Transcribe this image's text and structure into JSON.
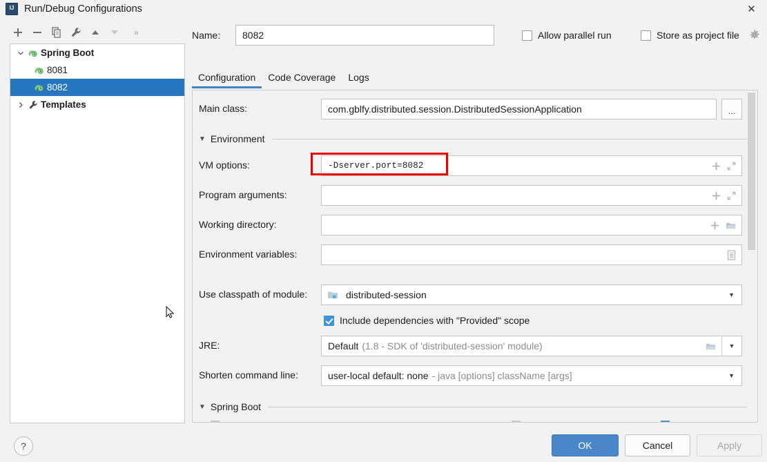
{
  "window": {
    "title": "Run/Debug Configurations",
    "app_icon": "intellij-idea-icon",
    "close_label": "✕"
  },
  "toolbar": {
    "add_label": "+",
    "remove_label": "−",
    "copy_label": "copy-icon",
    "edit_templates_label": "wrench-icon",
    "move_up_label": "move-up-icon",
    "move_down_label": "move-down-icon",
    "overflow_label": "»"
  },
  "tree": {
    "nodes": [
      {
        "label": "Spring Boot",
        "twisty": "⌄",
        "level": 0,
        "bold": true,
        "selected": false,
        "icon": "spring-boot-icon"
      },
      {
        "label": "8081",
        "twisty": "",
        "level": 1,
        "bold": false,
        "selected": false,
        "icon": "spring-boot-icon"
      },
      {
        "label": "8082",
        "twisty": "",
        "level": 1,
        "bold": false,
        "selected": true,
        "icon": "spring-boot-icon"
      },
      {
        "label": "Templates",
        "twisty": "›",
        "level": 0,
        "bold": true,
        "selected": false,
        "icon": "wrench-icon"
      }
    ]
  },
  "name_row": {
    "label": "Name:",
    "value": "8082",
    "placeholder": "",
    "allow_parallel_run": {
      "label": "Allow parallel run",
      "checked": false
    },
    "store_as_project_file": {
      "label": "Store as project file",
      "checked": false
    },
    "settings_gear": "gear-icon"
  },
  "tabs": [
    {
      "label": "Configuration",
      "active": true
    },
    {
      "label": "Code Coverage",
      "active": false
    },
    {
      "label": "Logs",
      "active": false
    }
  ],
  "form": {
    "main_class": {
      "label": "Main class:",
      "value": "com.gblfy.distributed.session.DistributedSessionApplication",
      "browse_label": "..."
    },
    "environment_section": {
      "label": "Environment",
      "caret": "▼",
      "expanded": true
    },
    "vm_options": {
      "label": "VM options:",
      "value": "-Dserver.port=8082",
      "placeholder": "",
      "icons": [
        "plus-icon",
        "expand-icon"
      ],
      "highlight_color": "#ef0000"
    },
    "program_arguments": {
      "label": "Program arguments:",
      "value": "",
      "placeholder": "",
      "icons": [
        "plus-icon",
        "expand-icon"
      ]
    },
    "working_directory": {
      "label": "Working directory:",
      "value": "",
      "placeholder": "",
      "icons": [
        "plus-icon",
        "folder-icon"
      ]
    },
    "environment_variables": {
      "label": "Environment variables:",
      "value": "",
      "placeholder": "",
      "icons": [
        "list-icon"
      ]
    },
    "use_classpath_of_module": {
      "label": "Use classpath of module:",
      "value": "distributed-session",
      "icon": "module-icon",
      "arrow": "▼"
    },
    "include_provided_scope": {
      "label": "Include dependencies with \"Provided\" scope",
      "checked": true
    },
    "jre": {
      "label": "JRE:",
      "value": "Default",
      "value_hint": "(1.8 - SDK of 'distributed-session' module)",
      "browse_icon": "folder-icon",
      "arrow": "▼"
    },
    "shorten_command_line": {
      "label": "Shorten command line:",
      "value": "user-local default: none",
      "value_hint": "- java [options] className [args]",
      "arrow": "▼"
    },
    "spring_boot_section": {
      "label": "Spring Boot",
      "caret": "▼",
      "expanded": true
    }
  },
  "footer": {
    "help_label": "?",
    "ok_label": "OK",
    "cancel_label": "Cancel",
    "apply_label": "Apply",
    "apply_enabled": false
  },
  "colors": {
    "accent": "#4a86c8",
    "selection": "#2675bf",
    "annotation": "#ef0000",
    "checkbox_checked": "#3d95d8"
  }
}
